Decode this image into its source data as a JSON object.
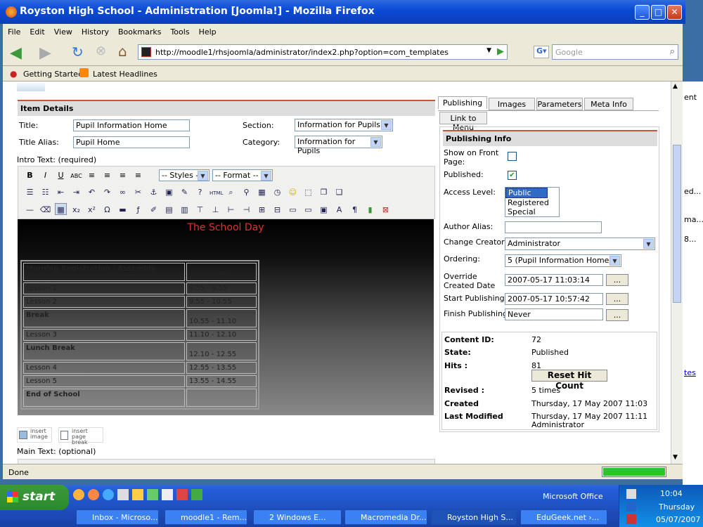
{
  "window": {
    "title": "Royston High School - Administration [Joomla!] - Mozilla Firefox"
  },
  "menu": [
    "File",
    "Edit",
    "View",
    "History",
    "Bookmarks",
    "Tools",
    "Help"
  ],
  "nav": {
    "url": "http://moodle1/rhsjoomla/administrator/index2.php?option=com_templates",
    "search_placeholder": "Google"
  },
  "bookmarks": [
    "Getting Started",
    "Latest Headlines"
  ],
  "page": {
    "item_details": "Item Details",
    "title_label": "Title:",
    "title_value": "Pupil Information Home",
    "alias_label": "Title Alias:",
    "alias_value": "Pupil Home",
    "section_label": "Section:",
    "section_value": "Information for Pupils",
    "category_label": "Category:",
    "category_value": "Information for Pupils",
    "intro_label": "Intro Text: (required)",
    "styles_value": "-- Styles --",
    "format_value": "-- Format --",
    "main_label": "Main Text: (optional)",
    "insert_image": "insert image",
    "insert_pagebreak": "insert page break"
  },
  "editor": {
    "heading": "The School Day",
    "rows": [
      [
        "Morning Registration / Assembly",
        "8.45 - 8.55"
      ],
      [
        "Lesson 1",
        "8.55 - 9.55"
      ],
      [
        "Lesson 2",
        "9.55 - 10.55"
      ],
      [
        "Break",
        "10.55 - 11.10"
      ],
      [
        "Lesson 3",
        "11.10 - 12.10"
      ],
      [
        "Lunch Break",
        "12.10 - 12.55"
      ],
      [
        "Lesson 4",
        "12.55 - 13.55"
      ],
      [
        "Lesson 5",
        "13.55 - 14.55"
      ],
      [
        "End of School",
        ""
      ]
    ]
  },
  "tabs": [
    "Publishing",
    "Images",
    "Parameters",
    "Meta Info",
    "Link to Menu"
  ],
  "publishing": {
    "head": "Publishing Info",
    "front_label": "Show on Front Page:",
    "published_label": "Published:",
    "published": true,
    "front": false,
    "access_label": "Access Level:",
    "access_options": [
      "Public",
      "Registered",
      "Special"
    ],
    "author_alias_label": "Author Alias:",
    "creator_label": "Change Creator:",
    "creator_value": "Administrator",
    "ordering_label": "Ordering:",
    "ordering_value": "5 (Pupil Information Home)",
    "override_label": "Override Created Date",
    "override_value": "2007-05-17 11:03:14",
    "start_label": "Start Publishing:",
    "start_value": "2007-05-17 10:57:42",
    "finish_label": "Finish Publishing:",
    "finish_value": "Never",
    "dots": "..."
  },
  "info": {
    "content_id_k": "Content ID:",
    "content_id_v": "72",
    "state_k": "State:",
    "state_v": "Published",
    "hits_k": "Hits :",
    "hits_v": "81",
    "reset": "Reset Hit Count",
    "revised_k": "Revised :",
    "revised_v": "5 times",
    "created_k": "Created",
    "created_v": "Thursday, 17 May 2007 11:03",
    "modified_k": "Last Modified",
    "modified_v": "Thursday, 17 May 2007 11:11",
    "modified_by": "Administrator"
  },
  "status": "Done",
  "taskbar": {
    "start": "start",
    "office": "Microsoft Office",
    "time": "10:04",
    "day": "Thursday",
    "date": "05/07/2007",
    "tasks": [
      "Inbox - Microso...",
      "moodle1 - Rem...",
      "2 Windows E...",
      "Macromedia Dr...",
      "Royston High S...",
      "EduGeek.net ›..."
    ]
  },
  "right_fragments": [
    "ent",
    "ed...",
    "ma...",
    "8...",
    "tes"
  ]
}
